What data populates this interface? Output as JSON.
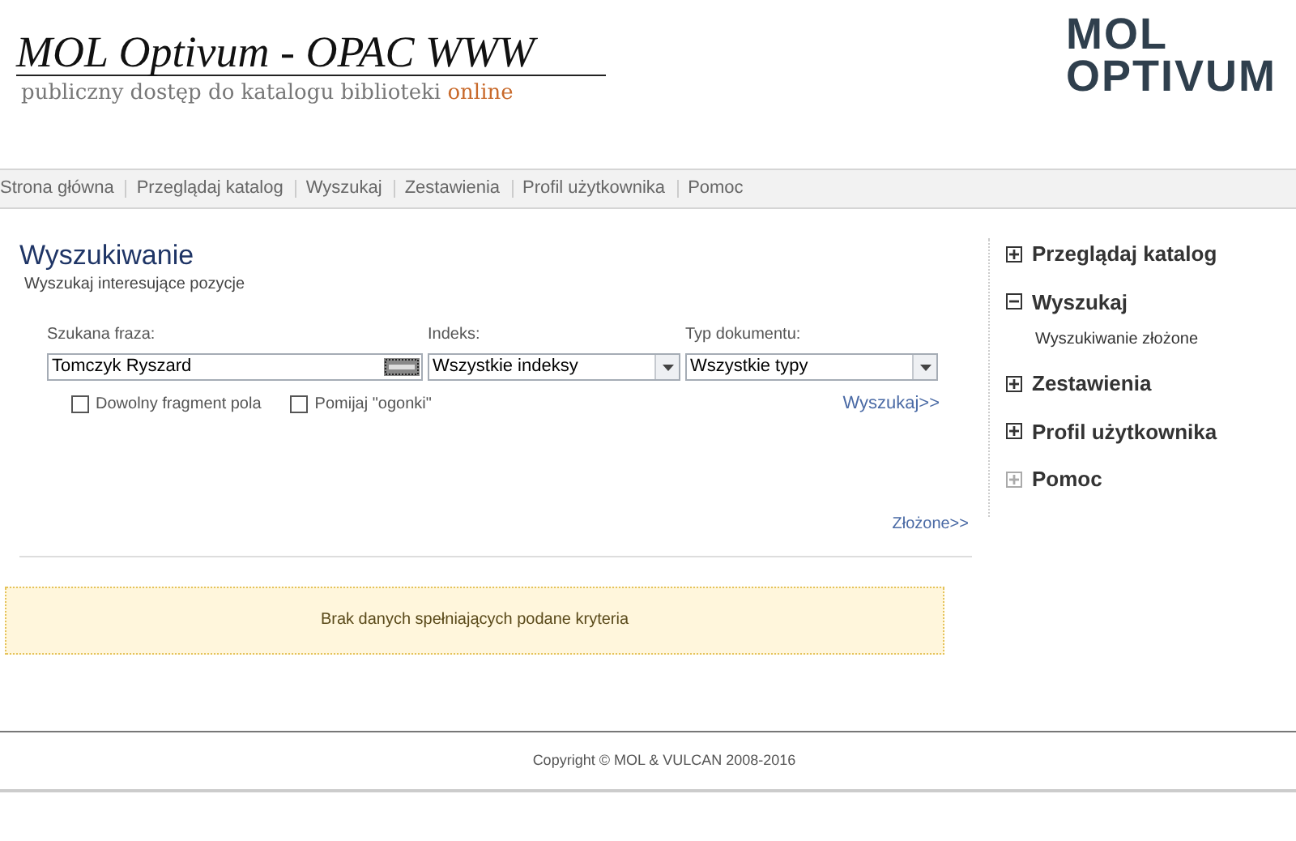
{
  "header": {
    "title": "MOL Optivum - OPAC WWW",
    "subtitle": "publiczny dostęp do katalogu biblioteki **online**",
    "logo_lines": [
      "MOL",
      "OPTIVUM"
    ]
  },
  "nav": {
    "items": [
      "Strona główna",
      "Przeglądaj katalog",
      "Wyszukaj",
      "Zestawienia",
      "Profil użytkownika",
      "Pomoc"
    ]
  },
  "search": {
    "title": "Wyszukiwanie",
    "subtitle": "Wyszukaj interesujące pozycje",
    "phrase": {
      "label": "Szukana fraza:",
      "value": "Tomczyk Ryszard"
    },
    "index": {
      "label": "Indeks:",
      "value": "Wszystkie indeksy"
    },
    "doc_type": {
      "label": "Typ dokumentu:",
      "value": "Wszystkie typy"
    },
    "options": [
      {
        "label": "Dowolny fragment pola",
        "checked": false
      },
      {
        "label": "Pomijaj \"ogonki\"",
        "checked": false
      }
    ],
    "search_link": "Wyszukaj>>",
    "advanced_link": "Złożone>>"
  },
  "message": "Brak danych spełniających podane kryteria",
  "sidebar": {
    "items": [
      {
        "label": "Przeglądaj katalog",
        "expanded": false,
        "expandable": true
      },
      {
        "label": "Wyszukaj",
        "expanded": true,
        "expandable": true,
        "children": [
          {
            "label": "Wyszukiwanie złożone"
          }
        ]
      },
      {
        "label": "Zestawienia",
        "expanded": false,
        "expandable": true
      },
      {
        "label": "Profil użytkownika",
        "expanded": false,
        "expandable": true
      },
      {
        "label": "Pomoc",
        "expanded": false,
        "expandable": false
      }
    ]
  },
  "footer": "Copyright © MOL & VULCAN 2008-2016"
}
